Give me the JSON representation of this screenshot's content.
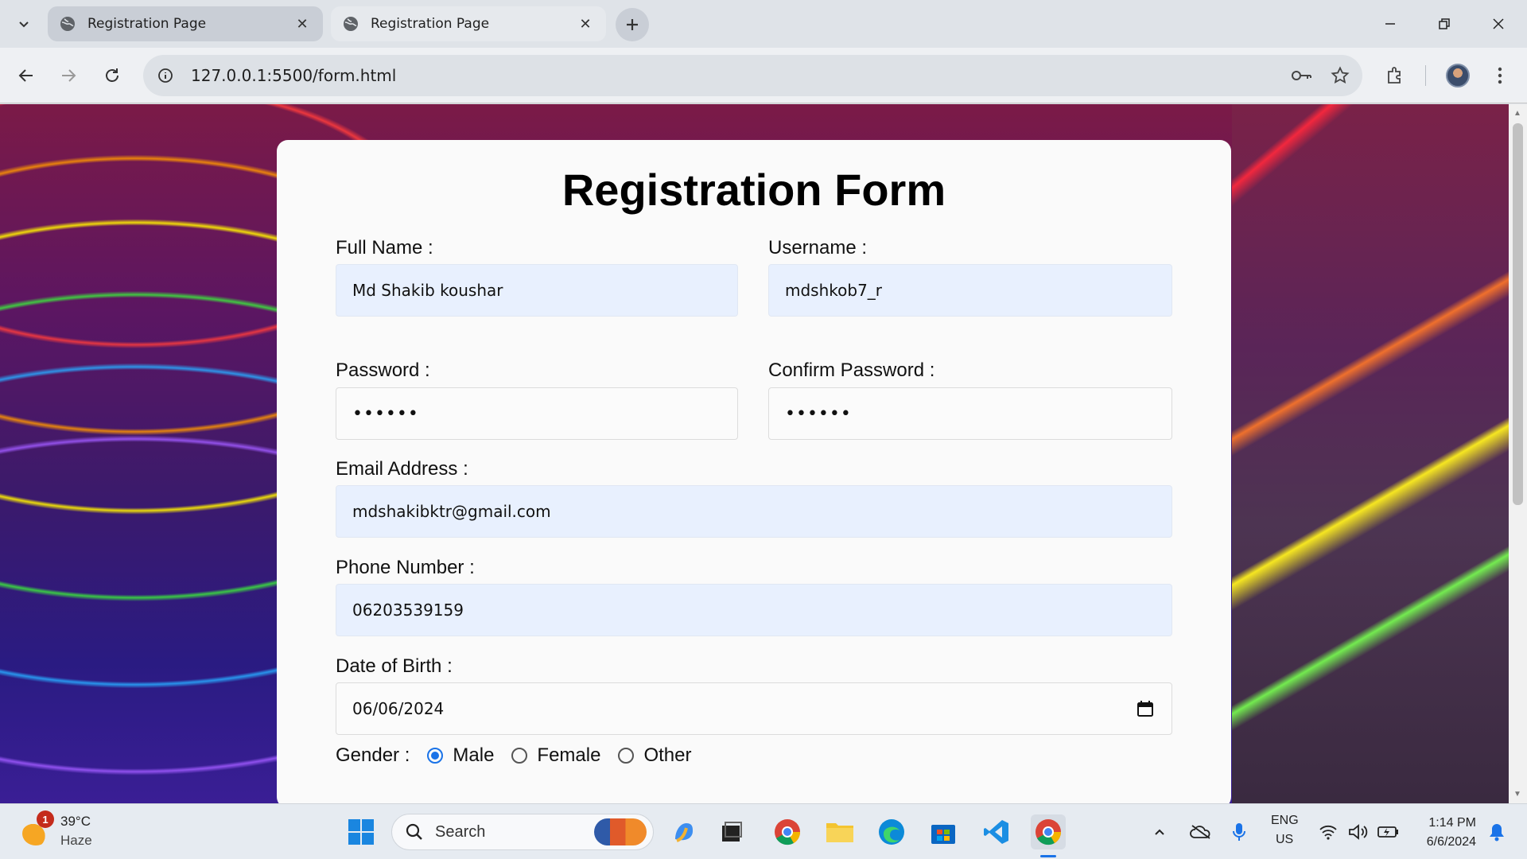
{
  "browser": {
    "tabs": [
      {
        "title": "Registration Page"
      },
      {
        "title": "Registration Page"
      }
    ],
    "url": "127.0.0.1:5500/form.html"
  },
  "form": {
    "title": "Registration Form",
    "full_name": {
      "label": "Full Name :",
      "value": "Md Shakib koushar"
    },
    "username": {
      "label": "Username :",
      "value": "mdshkob7_r"
    },
    "password": {
      "label": "Password :",
      "value": "••••••"
    },
    "confirm_password": {
      "label": "Confirm Password :",
      "value": "••••••"
    },
    "email": {
      "label": "Email Address :",
      "value": "mdshakibktr@gmail.com"
    },
    "phone": {
      "label": "Phone Number :",
      "value": "06203539159"
    },
    "dob": {
      "label": "Date of Birth :",
      "value": "06/06/2024"
    },
    "gender": {
      "label": "Gender :",
      "options": [
        "Male",
        "Female",
        "Other"
      ],
      "selected": "Male"
    }
  },
  "taskbar": {
    "weather": {
      "temp": "39°C",
      "condition": "Haze",
      "badge": "1"
    },
    "search_placeholder": "Search",
    "language": {
      "line1": "ENG",
      "line2": "US"
    },
    "time": "1:14 PM",
    "date": "6/6/2024"
  },
  "colors": {
    "accent": "#1a73e8",
    "autofill_bg": "#e8f0fe",
    "card_bg": "#fafafa"
  }
}
